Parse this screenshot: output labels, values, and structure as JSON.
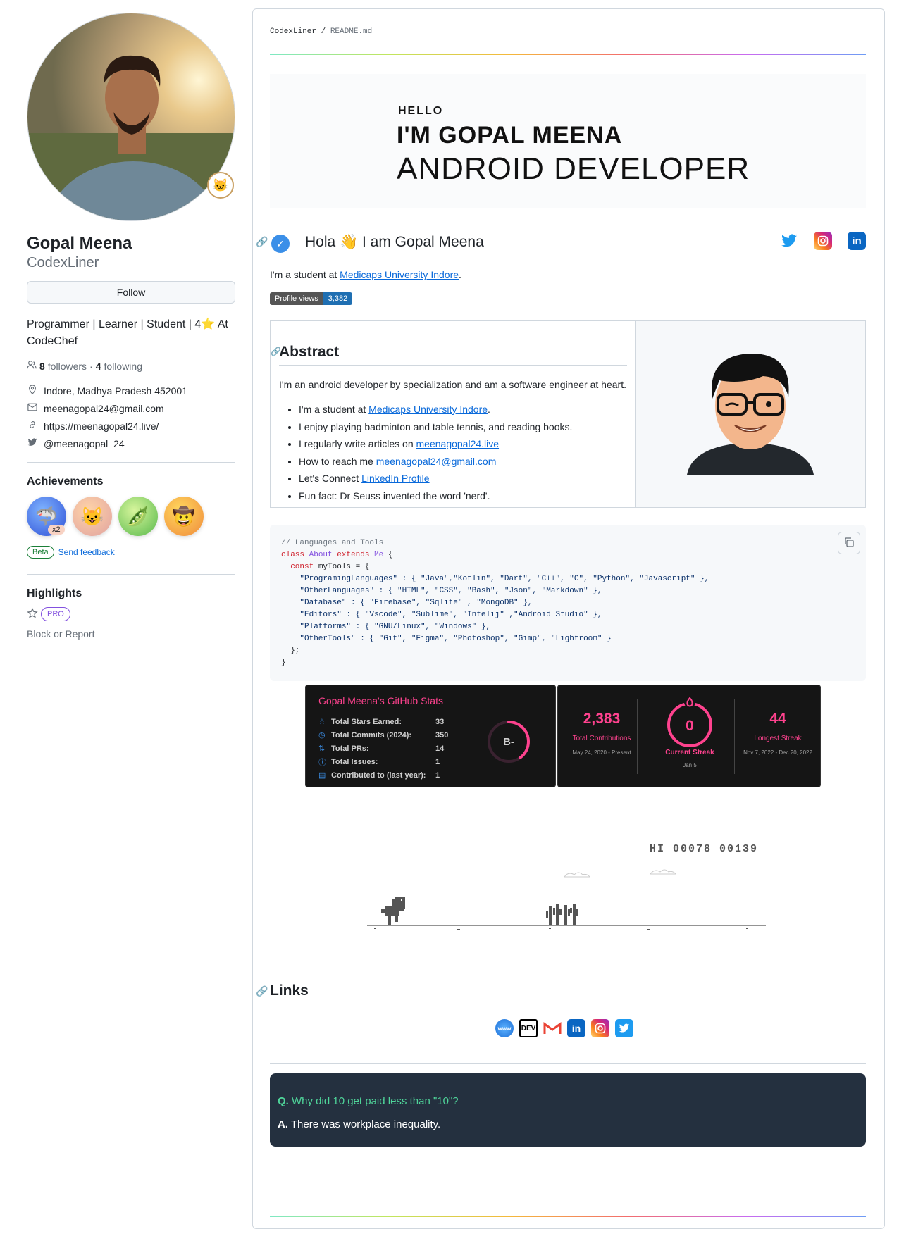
{
  "profile": {
    "name": "Gopal Meena",
    "login": "CodexLiner",
    "follow_label": "Follow",
    "bio": "Programmer | Learner | Student | 4⭐ At CodeChef",
    "followers_count": "8",
    "followers_label": "followers",
    "following_count": "4",
    "following_label": "following",
    "location": "Indore, Madhya Pradesh 452001",
    "email": "meenagopal24@gmail.com",
    "website": "https://meenagopal24.live/",
    "twitter": "@meenagopal_24"
  },
  "achievements": {
    "heading": "Achievements",
    "badge_count": "x2",
    "beta_label": "Beta",
    "feedback_label": "Send feedback"
  },
  "highlights": {
    "heading": "Highlights",
    "pro_label": "PRO",
    "block_label": "Block or Report"
  },
  "readme": {
    "crumb_user": "CodexLiner",
    "crumb_sep": " / ",
    "crumb_file": "README.md",
    "hero_hello": "HELLO",
    "hero_name": "I'M GOPAL MEENA",
    "hero_role": "ANDROID DEVELOPER",
    "hola_title": "Hola 👋 I am Gopal Meena",
    "intro_prefix": "I'm a student at ",
    "intro_link": "Medicaps University Indore",
    "intro_suffix": ".",
    "views_label": "Profile views",
    "views_count": "3,382",
    "abstract_heading": "Abstract",
    "abstract_text": "I'm an android developer by specialization and am a software engineer at heart.",
    "list": {
      "item1_prefix": "I'm a student at ",
      "item1_link": "Medicaps University Indore",
      "item1_suffix": ".",
      "item2": "I enjoy playing badminton and table tennis, and reading books.",
      "item3_prefix": "I regularly write articles on ",
      "item3_link": "meenagopal24.live",
      "item4_prefix": "How to reach me ",
      "item4_link": "meenagopal24@gmail.com",
      "item5_prefix": "Let's Connect ",
      "item5_link": "LinkedIn Profile",
      "item6": "Fun fact: Dr Seuss invented the word 'nerd'."
    }
  },
  "code": {
    "comment": "// Languages and Tools",
    "kw_class": "class",
    "class_name": "About",
    "kw_extends": "extends",
    "parent": "Me",
    "open": " {",
    "kw_const": "const",
    "var_line": " myTools = {",
    "lines": [
      "\"ProgramingLanguages\" : { \"Java\",\"Kotlin\", \"Dart\", \"C++\", \"C\", \"Python\", \"Javascript\" },",
      "\"OtherLanguages\" : { \"HTML\", \"CSS\", \"Bash\", \"Json\", \"Markdown\" },",
      "\"Database\" : { \"Firebase\", \"Sqlite\" , \"MongoDB\" },",
      "\"Editors\" : { \"Vscode\", \"Sublime\", \"Intelij\" ,\"Android Studio\" },",
      "\"Platforms\" : { \"GNU/Linux\", \"Windows\" },",
      "\"OtherTools\" : { \"Git\", \"Figma\", \"Photoshop\", \"Gimp\", \"Lightroom\" }"
    ],
    "close_inner": "};",
    "close_outer": "}"
  },
  "stats": {
    "title": "Gopal Meena's GitHub Stats",
    "rows": [
      {
        "label": "Total Stars Earned:",
        "value": "33"
      },
      {
        "label": "Total Commits (2024):",
        "value": "350"
      },
      {
        "label": "Total PRs:",
        "value": "14"
      },
      {
        "label": "Total Issues:",
        "value": "1"
      },
      {
        "label": "Contributed to (last year):",
        "value": "1"
      }
    ],
    "grade": "B-",
    "grade_progress": 0.4,
    "accent": "#fe428e"
  },
  "streak": {
    "total_value": "2,383",
    "total_label": "Total Contributions",
    "total_range": "May 24, 2020 - Present",
    "current_value": "0",
    "current_label": "Current Streak",
    "current_range": "Jan 5",
    "longest_value": "44",
    "longest_label": "Longest Streak",
    "longest_range": "Nov 7, 2022 - Dec 20, 2022"
  },
  "dino": {
    "score": "HI 00078  00139"
  },
  "links": {
    "heading": "Links",
    "icons": [
      "www-icon",
      "dev-icon",
      "gmail-icon",
      "linkedin-icon",
      "instagram-icon",
      "twitter-icon"
    ]
  },
  "joke": {
    "q_prefix": "Q.",
    "question": " Why did 10 get paid less than \"10\"?",
    "a_prefix": "A.",
    "answer": " There was workplace inequality."
  }
}
